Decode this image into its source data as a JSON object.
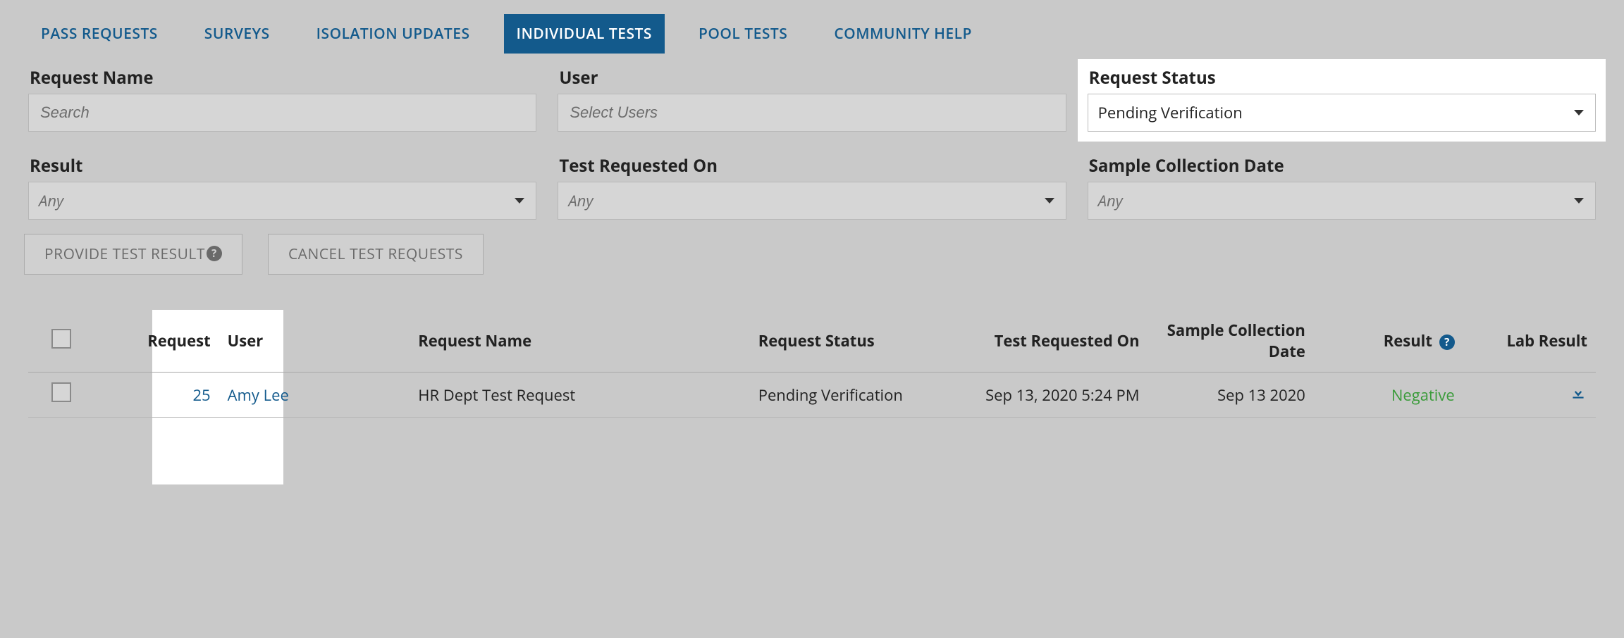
{
  "tabs": [
    {
      "label": "PASS REQUESTS",
      "active": false
    },
    {
      "label": "SURVEYS",
      "active": false
    },
    {
      "label": "ISOLATION UPDATES",
      "active": false
    },
    {
      "label": "INDIVIDUAL TESTS",
      "active": true
    },
    {
      "label": "POOL TESTS",
      "active": false
    },
    {
      "label": "COMMUNITY HELP",
      "active": false
    }
  ],
  "filters": {
    "request_name": {
      "label": "Request Name",
      "placeholder": "Search",
      "value": ""
    },
    "user": {
      "label": "User",
      "placeholder": "Select Users",
      "value": ""
    },
    "status": {
      "label": "Request Status",
      "value": "Pending Verification"
    },
    "result": {
      "label": "Result",
      "value": "Any"
    },
    "test_requested_on": {
      "label": "Test Requested On",
      "value": "Any"
    },
    "sample_collection": {
      "label": "Sample Collection Date",
      "value": "Any"
    }
  },
  "actions": {
    "provide_test_result": "PROVIDE TEST RESULT",
    "cancel_test_requests": "CANCEL TEST REQUESTS"
  },
  "columns": {
    "request": "Request",
    "user": "User",
    "request_name": "Request Name",
    "request_status": "Request Status",
    "test_requested_on": "Test Requested On",
    "sample_collection_date": "Sample Collection Date",
    "result": "Result",
    "lab_result": "Lab Result"
  },
  "rows": [
    {
      "request": "25",
      "user": "Amy Lee",
      "request_name": "HR Dept Test Request",
      "request_status": "Pending Verification",
      "test_requested_on": "Sep 13, 2020 5:24 PM",
      "sample_collection_date": "Sep 13 2020",
      "result": "Negative"
    }
  ]
}
